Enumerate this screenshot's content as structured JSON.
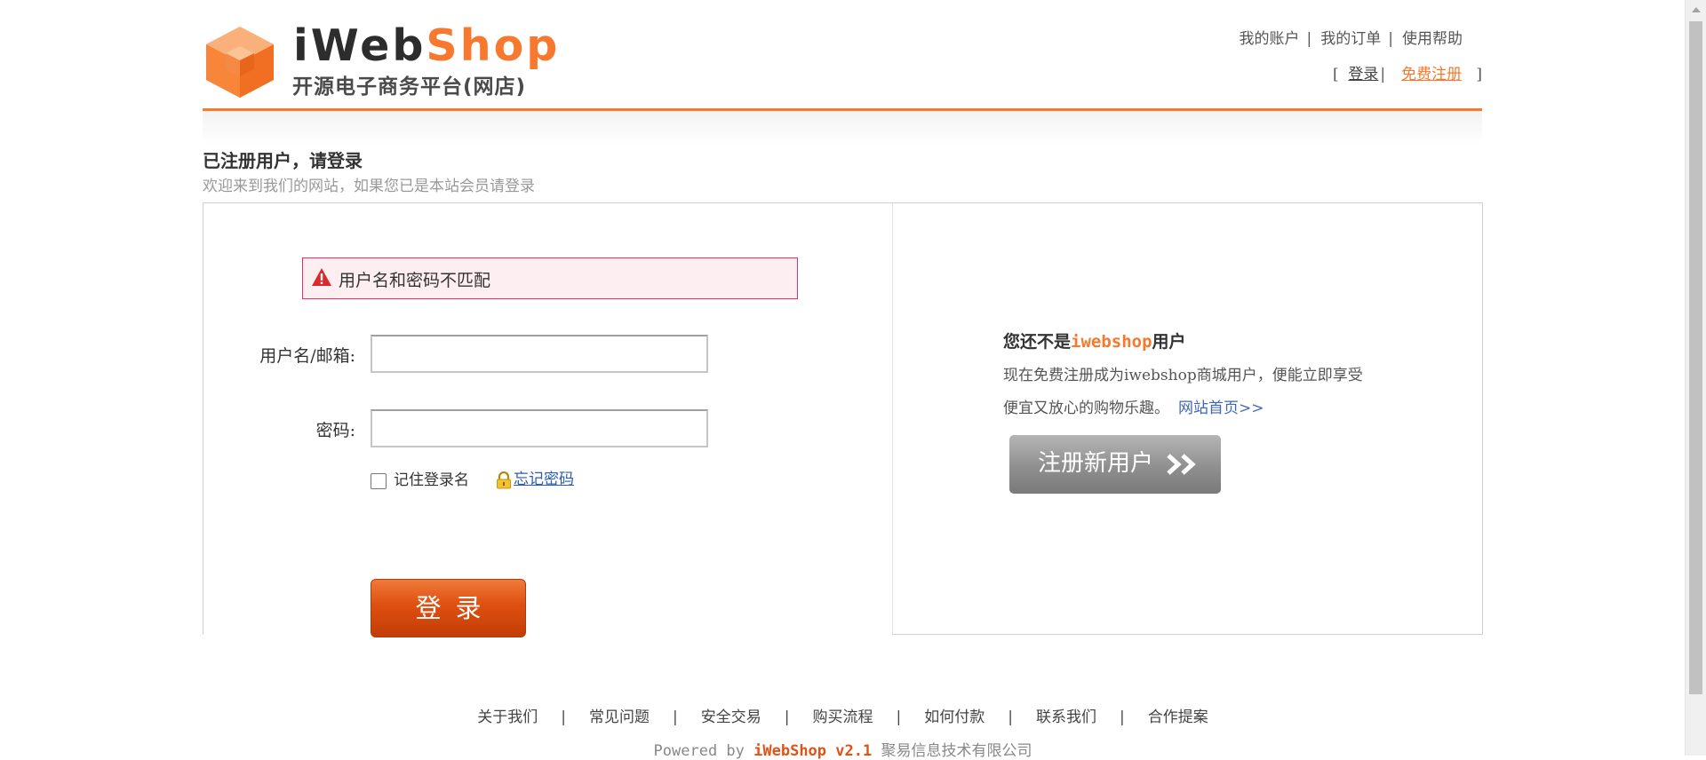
{
  "header": {
    "logo_word_a": "iWeb",
    "logo_word_b": "Shop",
    "logo_subtitle": "开源电子商务平台(网店)",
    "top_links": [
      "我的账户",
      "我的订单",
      "使用帮助"
    ],
    "sep": "|",
    "auth_open": "[",
    "auth_close": "]",
    "login_link": "登录",
    "register_link": "免费注册"
  },
  "page": {
    "title": "已注册用户，请登录",
    "subtitle": "欢迎来到我们的网站，如果您已是本站会员请登录"
  },
  "login_form": {
    "error_message": "用户名和密码不匹配",
    "username_label": "用户名/邮箱:",
    "username_value": "",
    "password_label": "密码:",
    "password_value": "",
    "remember_label": "记住登录名",
    "remember_checked": false,
    "forgot_link": "忘记密码",
    "submit_label": "登录"
  },
  "register_panel": {
    "title_prefix": "您还不是",
    "title_brand": "iwebshop",
    "title_suffix": "用户",
    "text_line1": "现在免费注册成为iwebshop商城用户，便能立即享受",
    "text_line2": "便宜又放心的购物乐趣。",
    "home_link": "网站首页>>",
    "register_button": "注册新用户"
  },
  "footer": {
    "links": [
      "关于我们",
      "常见问题",
      "安全交易",
      "购买流程",
      "如何付款",
      "联系我们",
      "合作提案"
    ],
    "powered_prefix": "Powered by ",
    "powered_version": "iWebShop v2.1",
    "company": "聚易信息技术有限公司"
  },
  "colors": {
    "accent_orange": "#f7792f",
    "error_border": "#e0306d",
    "error_bg": "#fdeef1",
    "link_blue": "#3f67b5"
  },
  "icons": {
    "logo": "orange-cube-logo-icon",
    "error": "warning-triangle-icon",
    "forgot": "lock-icon",
    "register": "double-chevron-right-icon"
  }
}
